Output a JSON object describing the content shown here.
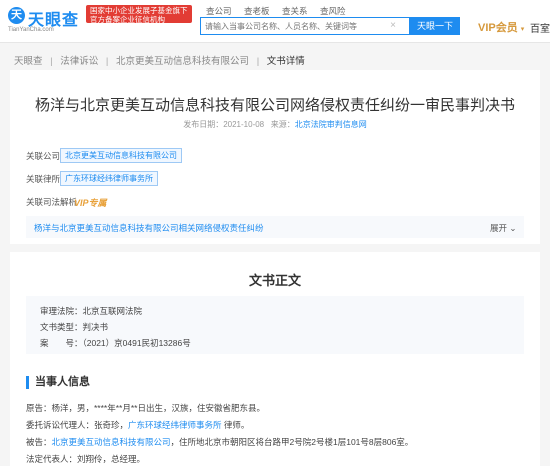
{
  "header": {
    "logo": {
      "text": "天眼查",
      "sub": "TianYanCha.com",
      "mark": "天"
    },
    "banner": {
      "line1": "国家中小企业发展子基金旗下",
      "line2": "官方备案企业征信机构"
    },
    "nav_tabs": [
      "查公司",
      "查老板",
      "查关系",
      "查风险"
    ],
    "search_placeholder": "请输入当事公司名称、人员名称、关键词等",
    "search_clear": "×",
    "search_button": "天眼一下",
    "vip": "VIP会员",
    "vip_caret": "▾",
    "baike": "百室"
  },
  "breadcrumb": [
    "天眼查",
    "法律诉讼",
    "北京更美互动信息科技有限公司",
    "文书详情"
  ],
  "breadcrumb_sep": "|",
  "document": {
    "title": "杨洋与北京更美互动信息科技有限公司网络侵权责任纠纷一审民事判决书",
    "date_label": "发布日期：",
    "date": "2021-10-08",
    "source_label": "来源：",
    "source": "北京法院审判信息网"
  },
  "related": {
    "company_label": "关联公司",
    "company": "北京更美互动信息科技有限公司",
    "lawfirm_label": "关联律所",
    "lawfirm": "广东环球经纬律师事务所",
    "analysis_label": "关联司法解析",
    "vip_tag": "VIP专属",
    "related_case": "杨洋与北京更美互动信息科技有限公司相关网络侵权责任纠纷",
    "expand": "展开",
    "expand_icon": "⌄"
  },
  "body": {
    "section_title": "文书正文",
    "court_line": "审理法院：北京互联网法院",
    "type_line": "文书类型：判决书",
    "case_no_line": "案　　号：（2021）京0491民初13286号",
    "party_head": "当事人信息",
    "plaintiff": "原告：杨洋，男，****年**月**日出生，汉族，住安徽省肥东县。",
    "agent_prefix": "委托诉讼代理人：张奇珍，",
    "agent_firm": "广东环球经纬律师事务所",
    "agent_suffix": "律师。",
    "defendant_prefix": "被告：",
    "defendant_company": "北京更美互动信息科技有限公司",
    "defendant_suffix": "，住所地北京市朝阳区将台路甲2号院2号楼1层101号8层806室。",
    "legal_rep": "法定代表人：刘翔伶，总经理。"
  }
}
